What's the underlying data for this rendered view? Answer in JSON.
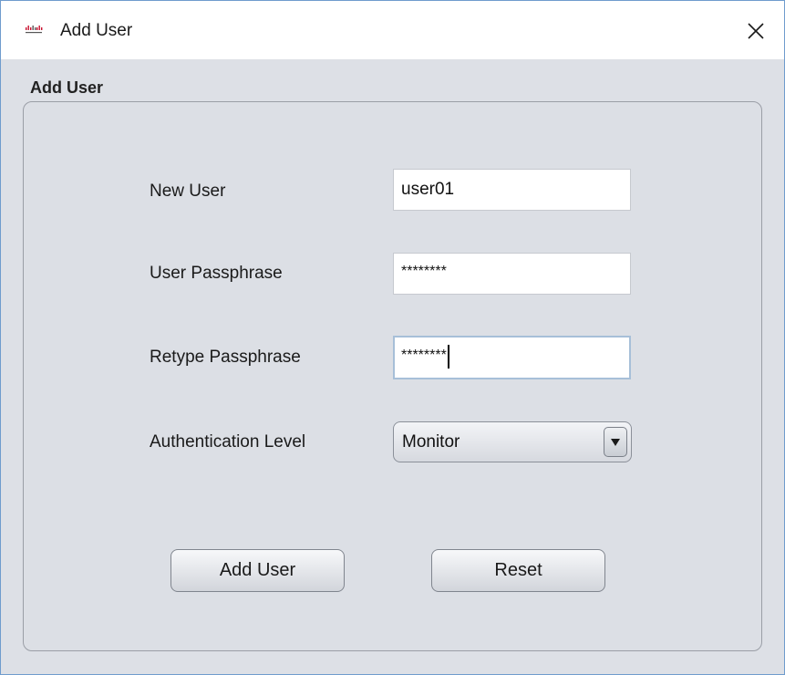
{
  "window": {
    "title": "Add User",
    "close_symbol": "✕",
    "icon": "cisco-logo-icon"
  },
  "panel": {
    "title": "Add User"
  },
  "form": {
    "new_user": {
      "label": "New User",
      "value": "user01"
    },
    "user_passphrase": {
      "label": "User Passphrase",
      "value": "********"
    },
    "retype_passphrase": {
      "label": "Retype Passphrase",
      "value": "********"
    },
    "auth_level": {
      "label": "Authentication Level",
      "value": "Monitor"
    }
  },
  "buttons": {
    "add_user": "Add User",
    "reset": "Reset"
  },
  "colors": {
    "window_border": "#6f9ccd",
    "panel_bg": "#dde0e6",
    "focus_border": "#a7bfd8"
  }
}
